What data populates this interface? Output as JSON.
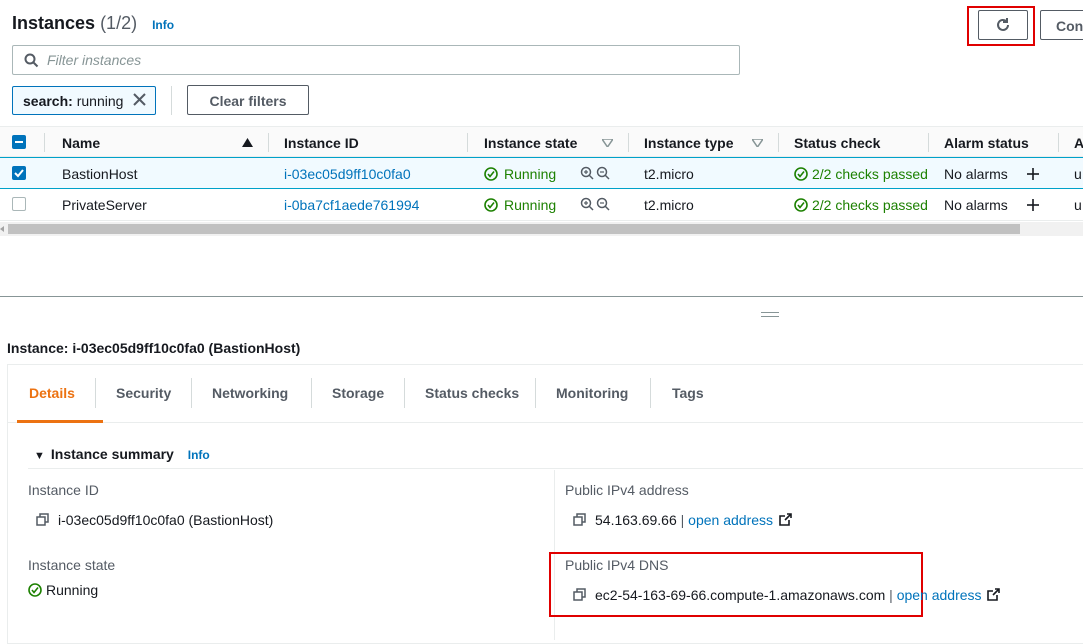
{
  "header": {
    "title": "Instances",
    "count": "(1/2)",
    "info": "Info",
    "con_label": "Con"
  },
  "filter": {
    "placeholder": "Filter instances"
  },
  "token": {
    "key": "search:",
    "value": "running"
  },
  "clear_filters": "Clear filters",
  "table": {
    "headers": [
      "Name",
      "Instance ID",
      "Instance state",
      "Instance type",
      "Status check",
      "Alarm status",
      "A"
    ],
    "rows": [
      {
        "name": "BastionHost",
        "id": "i-03ec05d9ff10c0fa0",
        "state": "Running",
        "type": "t2.micro",
        "status": "2/2 checks passed",
        "alarm": "No alarms",
        "extra": "u",
        "selected": true
      },
      {
        "name": "PrivateServer",
        "id": "i-0ba7cf1aede761994",
        "state": "Running",
        "type": "t2.micro",
        "status": "2/2 checks passed",
        "alarm": "No alarms",
        "extra": "u",
        "selected": false
      }
    ]
  },
  "details": {
    "title": "Instance: i-03ec05d9ff10c0fa0 (BastionHost)",
    "tabs": [
      "Details",
      "Security",
      "Networking",
      "Storage",
      "Status checks",
      "Monitoring",
      "Tags"
    ],
    "summary_title": "Instance summary",
    "summary_info": "Info",
    "instance_id_label": "Instance ID",
    "instance_id_value": "i-03ec05d9ff10c0fa0 (BastionHost)",
    "instance_state_label": "Instance state",
    "instance_state_value": "Running",
    "public_ipv4_label": "Public IPv4 address",
    "public_ipv4_value": "54.163.69.66",
    "public_dns_label": "Public IPv4 DNS",
    "public_dns_value": "ec2-54-163-69-66.compute-1.amazonaws.com",
    "separator": "|",
    "open_address": "open address"
  },
  "colors": {
    "accent": "#ec7211",
    "link": "#0073bb",
    "success": "#1d8102",
    "highlight": "#e00000"
  }
}
